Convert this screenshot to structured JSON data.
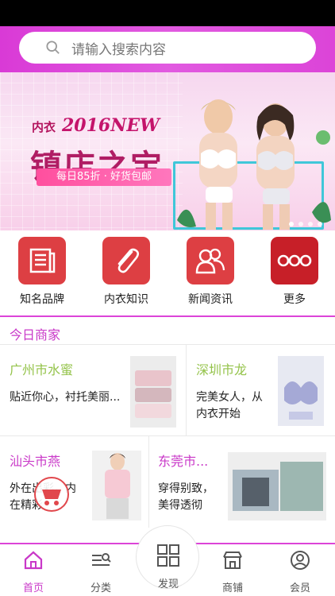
{
  "search": {
    "placeholder": "请输入搜索内容"
  },
  "banner": {
    "tag": "内衣",
    "year": "2016NEW",
    "headline": "镇店之宝",
    "promo": "每日85折 · 好货包邮",
    "dots": 4,
    "active_dot": 0
  },
  "categories": [
    {
      "label": "知名品牌",
      "icon": "newspaper-icon"
    },
    {
      "label": "内衣知识",
      "icon": "paperclip-icon"
    },
    {
      "label": "新闻资讯",
      "icon": "people-icon"
    },
    {
      "label": "更多",
      "icon": "more-dots-icon"
    }
  ],
  "section": {
    "title": "今日商家"
  },
  "merchants": [
    {
      "name": "广州市水蜜",
      "desc": "贴近你心，衬托美丽..."
    },
    {
      "name": "深圳市龙",
      "desc": "完美女人，从内衣开始"
    },
    {
      "name": "汕头市燕",
      "desc": "外在出彩，内在精彩"
    },
    {
      "name": "东莞市...",
      "desc": "穿得别致，美得透彻"
    }
  ],
  "bottom_nav": [
    {
      "label": "首页",
      "icon": "home-icon",
      "active": true
    },
    {
      "label": "分类",
      "icon": "category-icon",
      "active": false
    },
    {
      "label": "发现",
      "icon": "discover-icon",
      "active": false
    },
    {
      "label": "商铺",
      "icon": "shop-icon",
      "active": false
    },
    {
      "label": "会员",
      "icon": "member-icon",
      "active": false
    }
  ],
  "colors": {
    "accent": "#dc44d8",
    "tile": "#dd3f43",
    "merchant_name": "#94c34a"
  }
}
